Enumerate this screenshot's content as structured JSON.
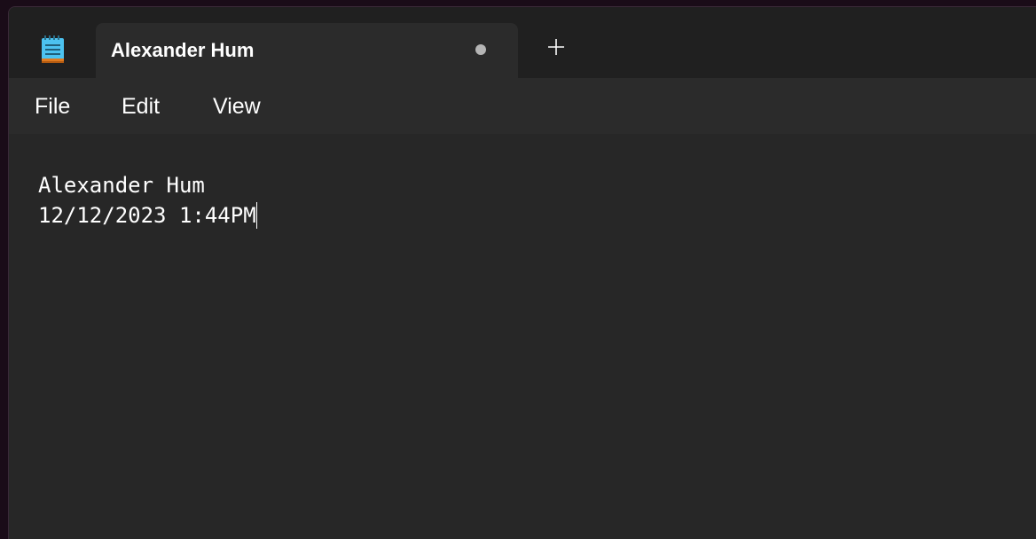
{
  "app": {
    "icon": "notepad-icon"
  },
  "tab": {
    "title": "Alexander Hum",
    "unsaved_indicator": "dot-icon"
  },
  "new_tab": {
    "icon": "plus-icon"
  },
  "menu": {
    "items": [
      {
        "label": "File"
      },
      {
        "label": "Edit"
      },
      {
        "label": "View"
      }
    ]
  },
  "editor": {
    "lines": [
      "Alexander Hum",
      "12/12/2023 1:44PM"
    ]
  },
  "colors": {
    "window_bg": "#202020",
    "tab_bg": "#2b2b2b",
    "editor_bg": "#272727",
    "text": "#ffffff",
    "accent": "#4fc3f7"
  }
}
